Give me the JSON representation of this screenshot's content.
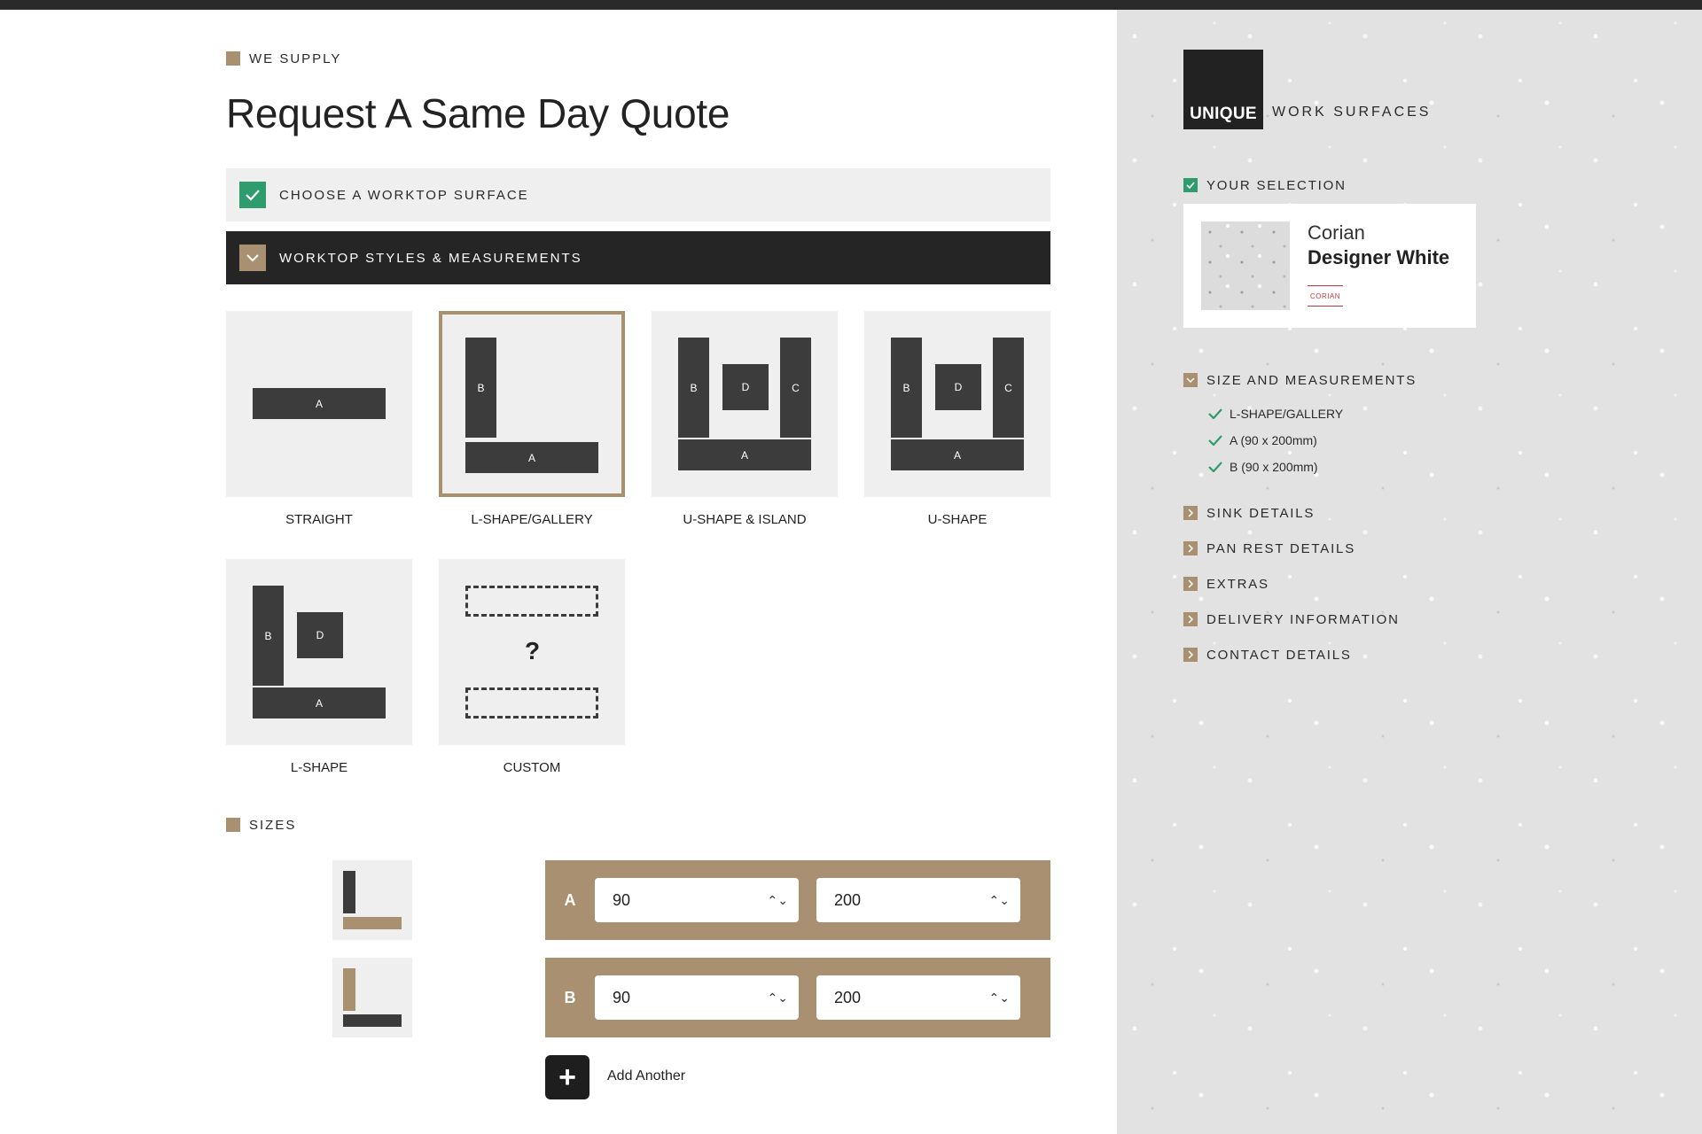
{
  "header": {
    "eyebrow": "WE SUPPLY",
    "title": "Request A Same Day Quote"
  },
  "steps": [
    {
      "label": "CHOOSE A WORKTOP SURFACE",
      "state": "complete"
    },
    {
      "label": "WORKTOP STYLES & MEASUREMENTS",
      "state": "open"
    }
  ],
  "shapes": [
    {
      "label": "STRAIGHT",
      "parts": [
        "A"
      ]
    },
    {
      "label": "L-SHAPE/GALLERY",
      "parts": [
        "B",
        "A"
      ],
      "selected": true
    },
    {
      "label": "U-SHAPE & ISLAND",
      "parts": [
        "B",
        "D",
        "C",
        "A"
      ]
    },
    {
      "label": "U-SHAPE",
      "parts": [
        "B",
        "D",
        "C",
        "A"
      ]
    },
    {
      "label": "L-SHAPE",
      "parts": [
        "B",
        "D",
        "A"
      ]
    },
    {
      "label": "CUSTOM",
      "symbol": "?"
    }
  ],
  "sizes": {
    "heading": "SIZES",
    "rows": [
      {
        "label": "A",
        "width": "90",
        "length": "200"
      },
      {
        "label": "B",
        "width": "90",
        "length": "200"
      }
    ],
    "add_label": "Add Another",
    "add_symbol": "+",
    "spinner_symbol": "⌃⌄"
  },
  "sidebar": {
    "logo_word": "UNIQUE",
    "logo_text": "WORK SURFACES",
    "selection_heading": "YOUR SELECTION",
    "selection": {
      "brand": "Corian",
      "name": "Designer White",
      "brand_logo": "CORIAN"
    },
    "size_heading": "SIZE AND MEASUREMENTS",
    "size_items": [
      "L-SHAPE/GALLERY",
      "A (90 x 200mm)",
      "B (90 x 200mm)"
    ],
    "sections": [
      "SINK DETAILS",
      "PAN REST DETAILS",
      "EXTRAS",
      "DELIVERY INFORMATION",
      "CONTACT DETAILS"
    ]
  },
  "colors": {
    "accent": "#a89070",
    "check_green": "#2f9c6e",
    "dark": "#252525",
    "tile_bg": "#efefef"
  }
}
